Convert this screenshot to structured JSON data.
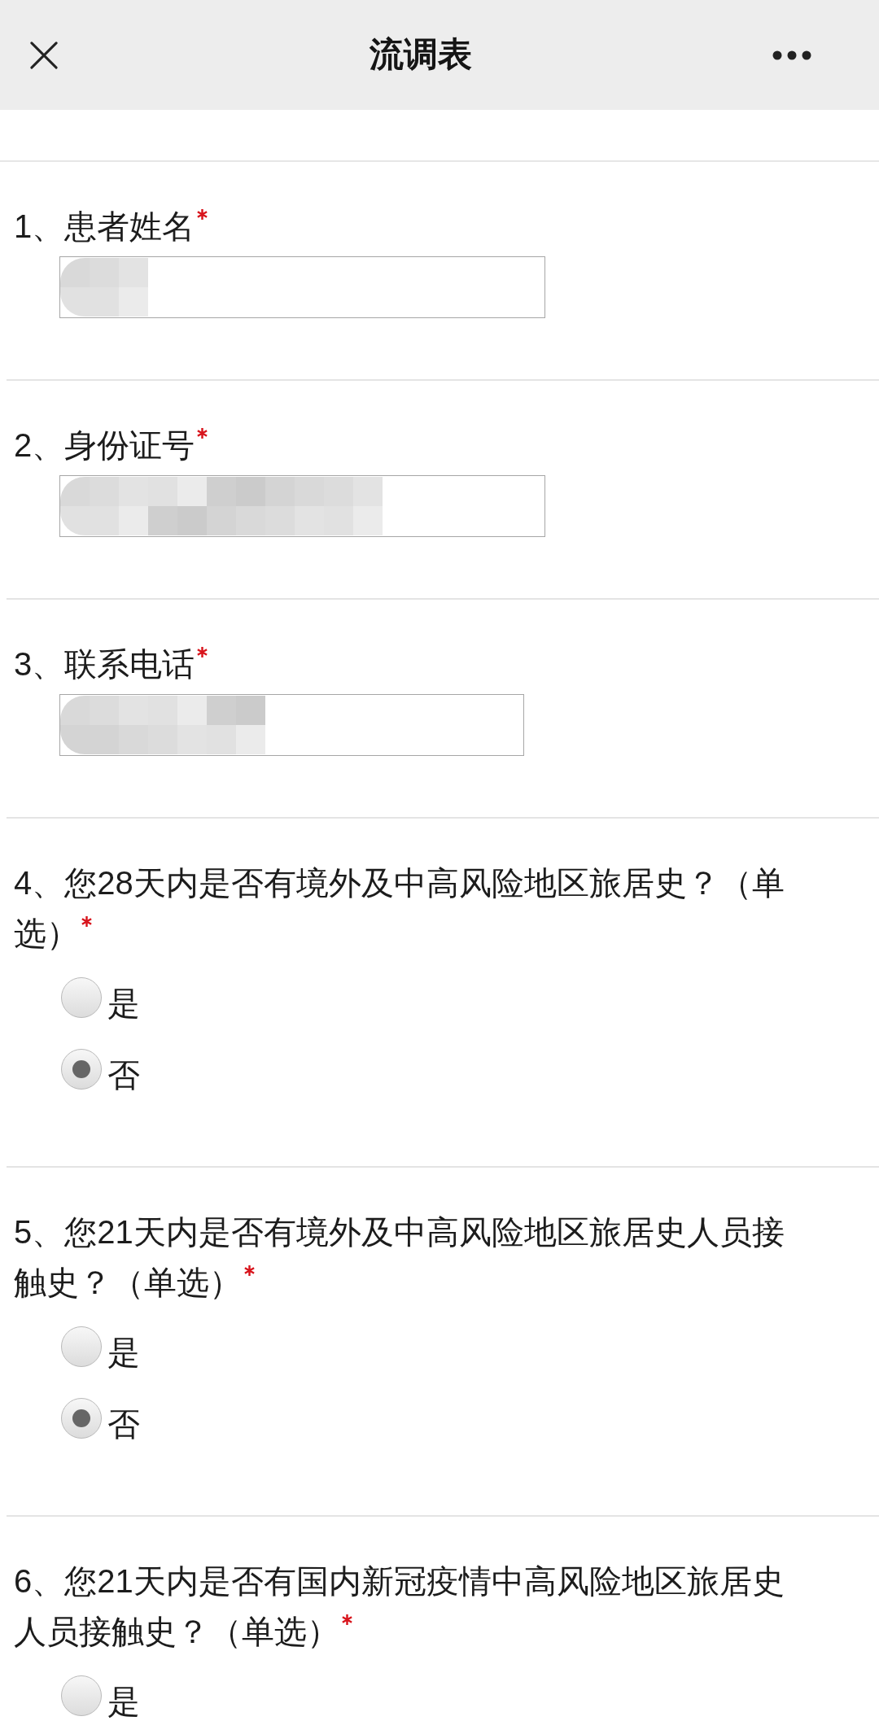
{
  "header": {
    "title": "流调表"
  },
  "questions": [
    {
      "kind": "text",
      "label": "1、患者姓名",
      "required": true,
      "field": {
        "value_redacted": true
      }
    },
    {
      "kind": "text",
      "label": "2、身份证号",
      "required": true,
      "field": {
        "value_redacted": true
      }
    },
    {
      "kind": "text",
      "label": "3、联系电话",
      "required": true,
      "field": {
        "value_redacted": true
      }
    },
    {
      "kind": "single_choice",
      "label": "4、您28天内是否有境外及中高风险地区旅居史？（单选）",
      "required": true,
      "options": [
        {
          "label": "是",
          "selected": false
        },
        {
          "label": "否",
          "selected": true
        }
      ]
    },
    {
      "kind": "single_choice",
      "label": "5、您21天内是否有境外及中高风险地区旅居史人员接触史？（单选）",
      "required": true,
      "options": [
        {
          "label": "是",
          "selected": false
        },
        {
          "label": "否",
          "selected": true
        }
      ]
    },
    {
      "kind": "single_choice",
      "label": "6、您21天内是否有国内新冠疫情中高风险地区旅居史人员接触史？（单选）",
      "required": true,
      "options": [
        {
          "label": "是",
          "selected": false
        }
      ]
    }
  ]
}
